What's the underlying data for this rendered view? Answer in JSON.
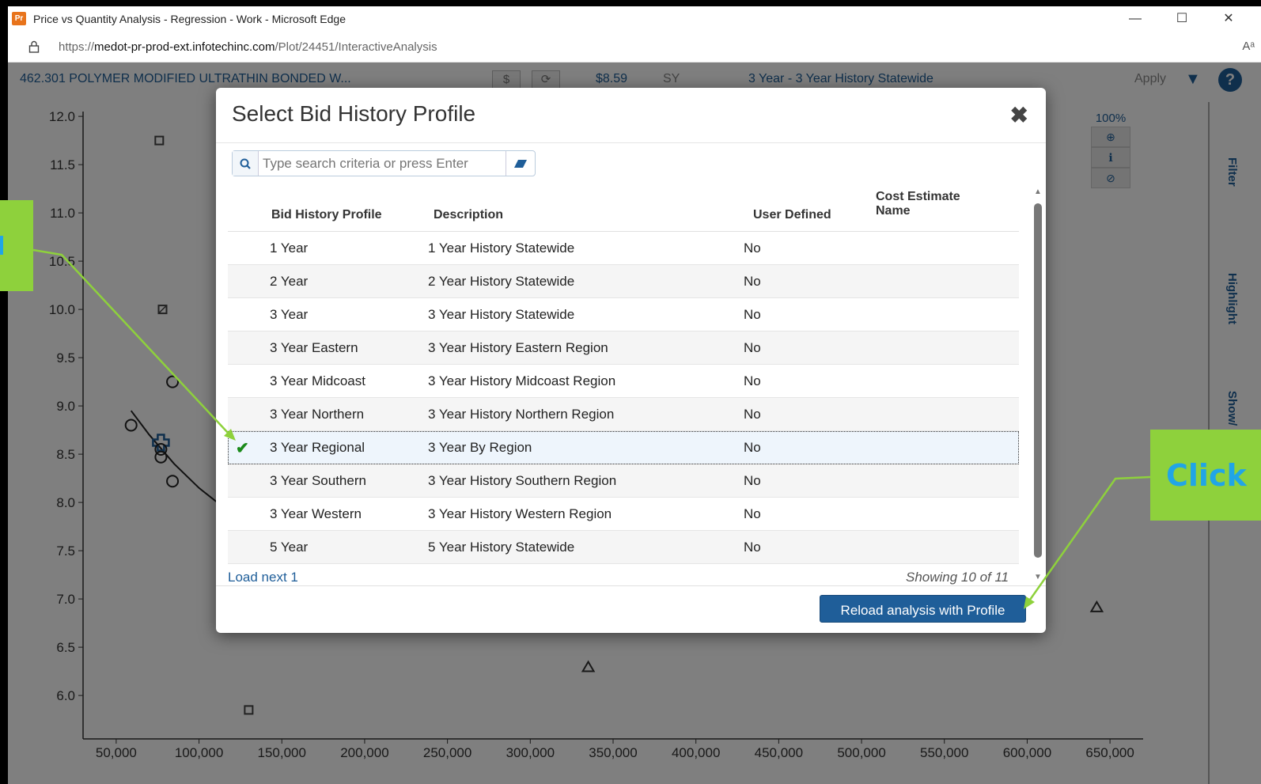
{
  "browser": {
    "app_icon_text": "Pr",
    "window_title": "Price vs Quantity Analysis - Regression - Work - Microsoft Edge",
    "url_prefix": "https://",
    "url_domain": "medot-pr-prod-ext.infotechinc.com",
    "url_path": "/Plot/24451/InteractiveAnalysis",
    "controls": {
      "minimize": "—",
      "maximize": "☐",
      "close": "✕"
    },
    "read_aloud": "Aᵃ"
  },
  "toolbar": {
    "item_name": "462.301 POLYMER MODIFIED ULTRATHIN BONDED W...",
    "dollar_btn": "$",
    "refresh_btn": "⟳",
    "price": "$8.59",
    "unit": "SY",
    "profile": "3 Year - 3 Year History Statewide",
    "apply": "Apply",
    "dropdown": "▼",
    "help": "?"
  },
  "side_tabs": [
    "Filter",
    "Highlight",
    "Show/"
  ],
  "zoom": {
    "pct": "100%",
    "zoom_in": "⊕",
    "info": "ℹ",
    "reset": "⊘"
  },
  "chart_data": {
    "type": "scatter",
    "yticks": [
      "6.0",
      "6.5",
      "7.0",
      "7.5",
      "8.0",
      "8.5",
      "9.0",
      "9.5",
      "10.0",
      "10.5",
      "11.0",
      "11.5",
      "12.0"
    ],
    "xticks": [
      "50,000",
      "100,000",
      "150,000",
      "200,000",
      "250,000",
      "300,000",
      "350,000",
      "400,000",
      "450,000",
      "500,000",
      "550,000",
      "600,000",
      "650,000"
    ],
    "xlim": [
      30000,
      670000
    ],
    "ylim": [
      5.55,
      12.05
    ],
    "points": [
      {
        "x": 76000,
        "y": 11.75,
        "shape": "square"
      },
      {
        "x": 78000,
        "y": 10.0,
        "shape": "square-x"
      },
      {
        "x": 84000,
        "y": 9.25,
        "shape": "circle"
      },
      {
        "x": 59000,
        "y": 8.8,
        "shape": "circle"
      },
      {
        "x": 77000,
        "y": 8.62,
        "shape": "cross"
      },
      {
        "x": 77000,
        "y": 8.55,
        "shape": "circle"
      },
      {
        "x": 77000,
        "y": 8.47,
        "shape": "circle"
      },
      {
        "x": 84000,
        "y": 8.22,
        "shape": "circle"
      },
      {
        "x": 130000,
        "y": 5.85,
        "shape": "square"
      },
      {
        "x": 335000,
        "y": 6.3,
        "shape": "triangle"
      },
      {
        "x": 642000,
        "y": 6.92,
        "shape": "triangle"
      }
    ],
    "fit_line": [
      [
        59000,
        8.95
      ],
      [
        70000,
        8.7
      ],
      [
        85000,
        8.4
      ],
      [
        100000,
        8.15
      ],
      [
        117000,
        7.92
      ]
    ]
  },
  "callouts": {
    "right_text": "Click"
  },
  "modal": {
    "title": "Select Bid History Profile",
    "close": "✖",
    "search_icon": "🔍",
    "search_placeholder": "Type search criteria or press Enter",
    "eraser_icon": "✎",
    "columns": {
      "profile": "Bid History Profile",
      "description": "Description",
      "user_defined": "User Defined",
      "cost_estimate_line1": "Cost Estimate",
      "cost_estimate_line2": "Name"
    },
    "rows": [
      {
        "profile": "1 Year",
        "description": "1 Year History Statewide",
        "user_defined": "No"
      },
      {
        "profile": "2 Year",
        "description": "2 Year History Statewide",
        "user_defined": "No"
      },
      {
        "profile": "3 Year",
        "description": "3 Year History Statewide",
        "user_defined": "No"
      },
      {
        "profile": "3 Year Eastern",
        "description": "3 Year History Eastern Region",
        "user_defined": "No"
      },
      {
        "profile": "3 Year Midcoast",
        "description": "3 Year History Midcoast Region",
        "user_defined": "No"
      },
      {
        "profile": "3 Year Northern",
        "description": "3 Year History Northern Region",
        "user_defined": "No"
      },
      {
        "profile": "3 Year Regional",
        "description": "3 Year By Region",
        "user_defined": "No",
        "selected": true
      },
      {
        "profile": "3 Year Southern",
        "description": "3 Year History Southern Region",
        "user_defined": "No"
      },
      {
        "profile": "3 Year Western",
        "description": "3 Year History Western Region",
        "user_defined": "No"
      },
      {
        "profile": "5 Year",
        "description": "5 Year History Statewide",
        "user_defined": "No"
      }
    ],
    "check_icon": "✔",
    "load_next": "Load next 1",
    "showing": "Showing 10 of 11",
    "reload_button": "Reload analysis with Profile"
  },
  "colors": {
    "accent": "#1f5e99",
    "callout": "#8ed13c",
    "check": "#1a8a1a"
  }
}
